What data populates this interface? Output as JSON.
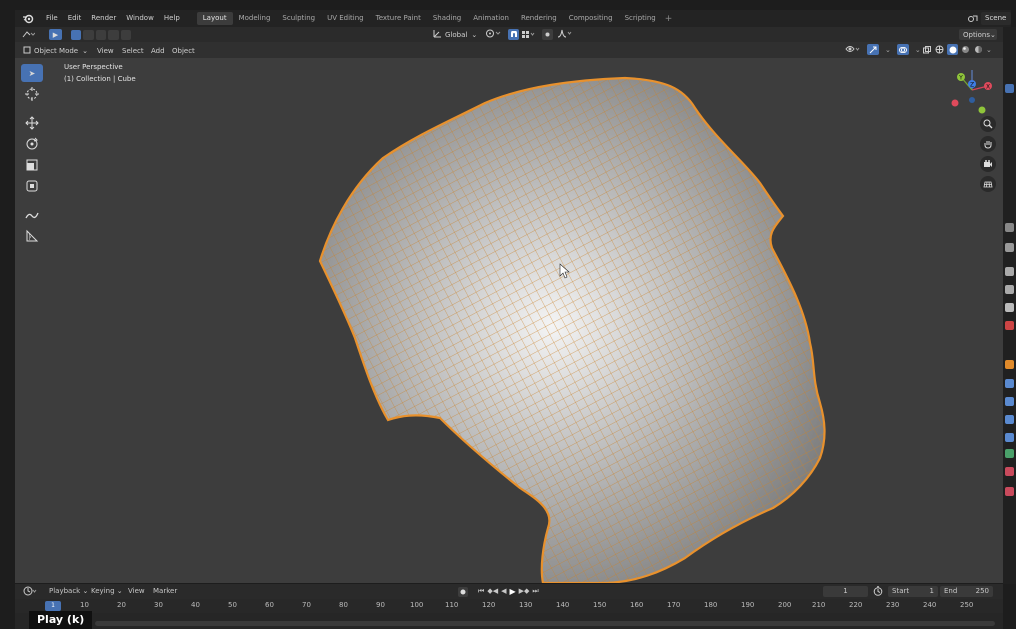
{
  "menu": {
    "items": [
      "File",
      "Edit",
      "Render",
      "Window",
      "Help"
    ]
  },
  "workspaces": {
    "tabs": [
      "Layout",
      "Modeling",
      "Sculpting",
      "UV Editing",
      "Texture Paint",
      "Shading",
      "Animation",
      "Rendering",
      "Compositing",
      "Scripting"
    ],
    "active": "Layout",
    "add_label": "+"
  },
  "scene": {
    "label": "Scene"
  },
  "toolheader": {
    "transform_orientation": "Global",
    "options_label": "Options"
  },
  "viewport_header": {
    "mode": "Object Mode",
    "menus": [
      "View",
      "Select",
      "Add",
      "Object"
    ]
  },
  "viewport": {
    "view_name": "User Perspective",
    "collection_info": "(1) Collection | Cube",
    "mesh_wire_color": "#e8912d",
    "gizmo": {
      "x_color": "#e04a5c",
      "y_color": "#8fc53a",
      "z_color": "#3f7ee6"
    }
  },
  "timeline": {
    "menus": [
      "Playback",
      "Keying",
      "View",
      "Marker"
    ],
    "current_frame": "1",
    "start_label": "Start",
    "start_value": "1",
    "end_label": "End",
    "end_value": "250",
    "ruler_labels": [
      "1",
      "10",
      "20",
      "30",
      "40",
      "50",
      "60",
      "70",
      "80",
      "90",
      "100",
      "110",
      "120",
      "130",
      "140",
      "150",
      "160",
      "170",
      "180",
      "190",
      "200",
      "210",
      "220",
      "230",
      "240",
      "250"
    ]
  },
  "tooltip": {
    "text": "Play (k)"
  },
  "colors": {
    "accent": "#4772b3",
    "viewport_bg": "#3d3d3d",
    "header_bg": "#2b2b2b"
  }
}
